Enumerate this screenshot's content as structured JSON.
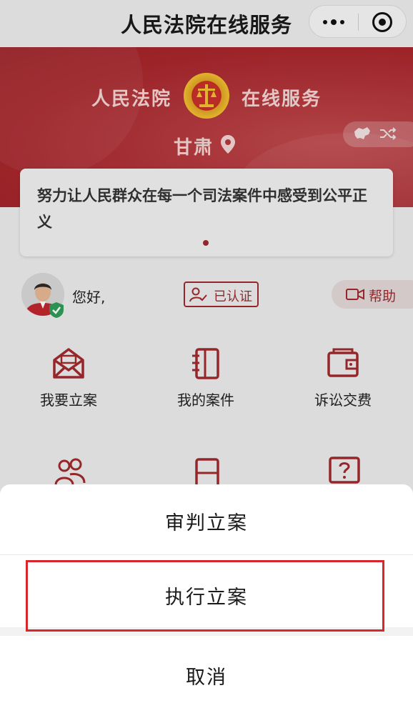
{
  "app": {
    "title": "人民法院在线服务"
  },
  "banner": {
    "left_text": "人民法院",
    "right_text": "在线服务",
    "region": "甘肃"
  },
  "notice": {
    "text": "努力让人民群众在每一个司法案件中感受到公平正义"
  },
  "user": {
    "greeting": "您好,",
    "verified_label": "已认证",
    "help_label": "帮助"
  },
  "grid": {
    "items": [
      {
        "label": "我要立案",
        "icon": "envelope-case-icon"
      },
      {
        "label": "我的案件",
        "icon": "notebook-icon"
      },
      {
        "label": "诉讼交费",
        "icon": "wallet-icon"
      }
    ]
  },
  "sheet": {
    "option1": "审判立案",
    "option2": "执行立案",
    "cancel": "取消"
  },
  "colors": {
    "brand_red": "#a12a2e",
    "highlight_red": "#d7262c"
  }
}
